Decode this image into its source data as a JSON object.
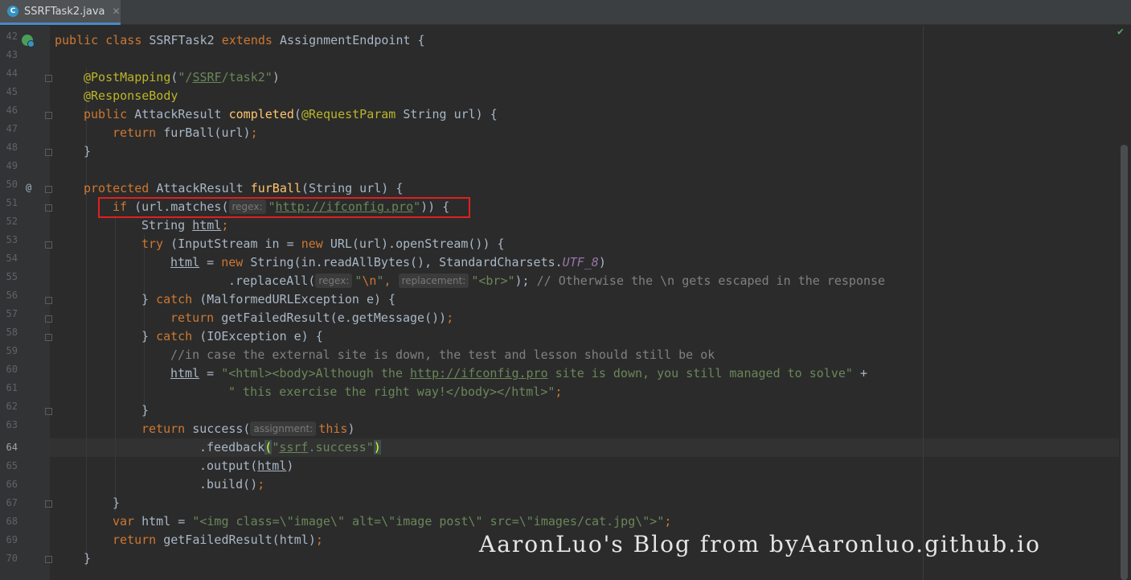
{
  "tab": {
    "icon": "C",
    "title": "SSRFTask2.java",
    "close": "✕"
  },
  "lines": [
    {
      "n": "42"
    },
    {
      "n": "43"
    },
    {
      "n": "44"
    },
    {
      "n": "45"
    },
    {
      "n": "46"
    },
    {
      "n": "47"
    },
    {
      "n": "48"
    },
    {
      "n": "49"
    },
    {
      "n": "50"
    },
    {
      "n": "51"
    },
    {
      "n": "52"
    },
    {
      "n": "53"
    },
    {
      "n": "54"
    },
    {
      "n": "55"
    },
    {
      "n": "56"
    },
    {
      "n": "57"
    },
    {
      "n": "58"
    },
    {
      "n": "59"
    },
    {
      "n": "60"
    },
    {
      "n": "61"
    },
    {
      "n": "62"
    },
    {
      "n": "63"
    },
    {
      "n": "64"
    },
    {
      "n": "65"
    },
    {
      "n": "66"
    },
    {
      "n": "67"
    },
    {
      "n": "68"
    },
    {
      "n": "69"
    },
    {
      "n": "70"
    }
  ],
  "code": {
    "l42": {
      "a": "public class ",
      "b": "SSRFTask2 ",
      "c": "extends ",
      "d": "AssignmentEndpoint {"
    },
    "l44": {
      "a": "@PostMapping",
      "b": "(",
      "c": "\"/",
      "d": "SSRF",
      "e": "/task2\"",
      "f": ")"
    },
    "l45": {
      "a": "@ResponseBody"
    },
    "l46": {
      "a": "public ",
      "b": "AttackResult ",
      "c": "completed",
      "d": "(",
      "e": "@RequestParam ",
      "f": "String url) {"
    },
    "l47": {
      "a": "return ",
      "b": "furBall(url)",
      "c": ";"
    },
    "l48": {
      "a": "}"
    },
    "l50": {
      "a": "protected ",
      "b": "AttackResult ",
      "c": "furBall",
      "d": "(String url) {"
    },
    "l51": {
      "a": "if ",
      "b": "(url.matches(",
      "hint": "regex:",
      "c": "\"",
      "d": "http://ifconfig.pro",
      "e": "\"",
      "f": ")) {"
    },
    "l52": {
      "a": "String ",
      "b": "html",
      "c": ";"
    },
    "l53": {
      "a": "try ",
      "b": "(InputStream in = ",
      "c": "new ",
      "d": "URL(url).openStream()) {"
    },
    "l54": {
      "a": "html",
      "b": " = ",
      "c": "new ",
      "d": "String(in.readAllBytes(), StandardCharsets.",
      "e": "UTF_8",
      "f": ")"
    },
    "l55": {
      "a": ".replaceAll(",
      "hint1": "regex:",
      "b": "\"",
      "c": "\\n",
      "d": "\"",
      "e": ", ",
      "hint2": "replacement:",
      "f": "\"<br>\"",
      "g": "); ",
      "h": "// Otherwise the \\n gets escaped in the response"
    },
    "l56": {
      "a": "} ",
      "b": "catch ",
      "c": "(MalformedURLException e) {"
    },
    "l57": {
      "a": "return ",
      "b": "getFailedResult(e.getMessage())",
      "c": ";"
    },
    "l58": {
      "a": "} ",
      "b": "catch ",
      "c": "(IOException e) {"
    },
    "l59": {
      "a": "//in case the external site is down, the test and lesson should still be ok"
    },
    "l60": {
      "a": "html",
      "b": " = ",
      "c": "\"<html><body>Although the ",
      "d": "http://ifconfig.pro",
      "e": " site is down, you still managed to solve\"",
      "f": " +"
    },
    "l61": {
      "a": "\" this exercise the right way!</body></html>\"",
      "b": ";"
    },
    "l62": {
      "a": "}"
    },
    "l63": {
      "a": "return ",
      "b": "success(",
      "hint": "assignment:",
      "c": "this",
      "d": ")"
    },
    "l64": {
      "a": ".feedback",
      "b": "(",
      "c": "\"",
      "d": "ssrf",
      "e": ".success\"",
      "f": ")"
    },
    "l65": {
      "a": ".output(",
      "b": "html",
      "c": ")"
    },
    "l66": {
      "a": ".build()",
      "b": ";"
    },
    "l67": {
      "a": "}"
    },
    "l68": {
      "a": "var ",
      "b": "html = ",
      "c": "\"<img class=\\\"image\\\" alt=\\\"image post\\\" src=\\\"images/cat.jpg\\\">\"",
      "d": ";"
    },
    "l69": {
      "a": "return ",
      "b": "getFailedResult(html)",
      "c": ";"
    },
    "l70": {
      "a": "}"
    }
  },
  "watermark": "AaronLuo's Blog from byAaronluo.github.io",
  "status": {
    "check_icon": "check-icon",
    "check_color": "#59a869"
  },
  "colors": {
    "keyword": "#cc7832",
    "annotation": "#bbb529",
    "string": "#6a8759",
    "method": "#ffc66d",
    "comment": "#808080",
    "highlight_box": "#e0201e"
  }
}
